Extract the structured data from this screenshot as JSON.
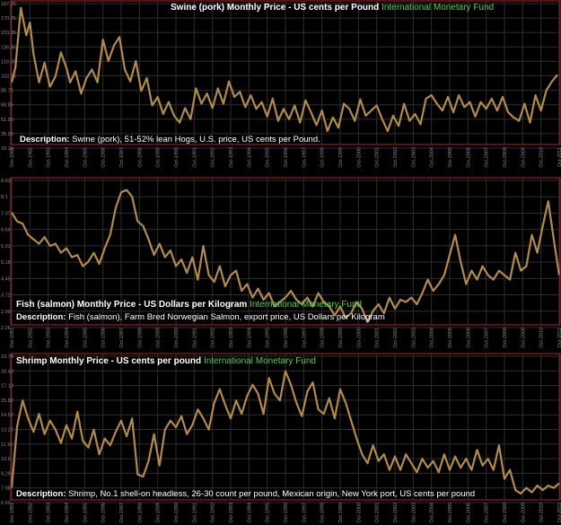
{
  "colors": {
    "line": "#b08a4e",
    "frame": "#a8232b",
    "grid": "#2e2e2e",
    "label": "#8a8a8a",
    "source": "#4fd14f"
  },
  "chart_data": [
    {
      "type": "line",
      "title": "Swine (pork) Monthly Price - US cents per Pound",
      "source": "International Monetary Fund",
      "description_label": "Description:",
      "description": "Swine (pork), 51-52% lean Hogs, U.S. price, US cents per Pound.",
      "y_ticks": [
        "187.15",
        "170.25",
        "153.35",
        "136.45",
        "119.55",
        "102.65",
        "85.75",
        "68.85",
        "51.95",
        "35.05",
        "18.15"
      ],
      "ylim": [
        18.15,
        187.15
      ],
      "x_ticks": [
        "Oct-1981",
        "Oct-1982",
        "Oct-1983",
        "Oct-1984",
        "Oct-1985",
        "Oct-1986",
        "Oct-1987",
        "Oct-1988",
        "Oct-1989",
        "Oct-1990",
        "Oct-1991",
        "Oct-1992",
        "Oct-1993",
        "Oct-1994",
        "Oct-1995",
        "Oct-1996",
        "Oct-1997",
        "Oct-1998",
        "Oct-1999",
        "Oct-2000",
        "Oct-2001",
        "Oct-2002",
        "Oct-2003",
        "Oct-2004",
        "Oct-2005",
        "Oct-2006",
        "Oct-2007",
        "Oct-2008",
        "Oct-2009",
        "Oct-2010",
        "Oct-2011"
      ],
      "series": [
        {
          "x": [
            1981.8,
            1982.0,
            1982.3,
            1982.6,
            1982.8,
            1983.0,
            1983.3,
            1983.6,
            1983.9,
            1984.2,
            1984.5,
            1984.8,
            1985.0,
            1985.3,
            1985.6,
            1985.9,
            1986.2,
            1986.5,
            1986.8,
            1987.1,
            1987.4,
            1987.7,
            1988.0,
            1988.3,
            1988.6,
            1988.9,
            1989.2,
            1989.5,
            1989.8,
            1990.1,
            1990.4,
            1990.7,
            1991.0,
            1991.3,
            1991.6,
            1991.9,
            1992.2,
            1992.5,
            1992.8,
            1993.1,
            1993.4,
            1993.7,
            1994.0,
            1994.3,
            1994.6,
            1994.9,
            1995.2,
            1995.5,
            1995.8,
            1996.1,
            1996.4,
            1996.7,
            1997.0,
            1997.3,
            1997.6,
            1997.9,
            1998.2,
            1998.5,
            1998.8,
            1999.1,
            1999.4,
            1999.7,
            2000.0,
            2000.3,
            2000.6,
            2000.9,
            2001.2,
            2001.5,
            2001.8,
            2002.1,
            2002.4,
            2002.7,
            2003.0,
            2003.3,
            2003.6,
            2003.9,
            2004.2,
            2004.5,
            2004.8,
            2005.1,
            2005.4,
            2005.7,
            2006.0,
            2006.3,
            2006.6,
            2006.9,
            2007.2,
            2007.5,
            2007.8,
            2008.1,
            2008.4,
            2008.7,
            2009.0,
            2009.3,
            2009.6,
            2009.9,
            2010.2,
            2010.5,
            2010.8,
            2011.1,
            2011.4,
            2011.7
          ],
          "y": [
            95,
            112,
            182,
            150,
            165,
            128,
            95,
            118,
            90,
            102,
            130,
            112,
            95,
            108,
            82,
            100,
            110,
            95,
            145,
            120,
            138,
            148,
            110,
            96,
            120,
            85,
            100,
            68,
            78,
            58,
            72,
            56,
            48,
            65,
            52,
            88,
            70,
            82,
            65,
            88,
            70,
            96,
            78,
            84,
            66,
            80,
            64,
            72,
            55,
            76,
            50,
            64,
            52,
            68,
            48,
            74,
            60,
            45,
            62,
            38,
            54,
            42,
            70,
            64,
            50,
            75,
            56,
            62,
            68,
            52,
            38,
            56,
            44,
            70,
            50,
            58,
            46,
            76,
            80,
            70,
            62,
            78,
            60,
            80,
            66,
            72,
            55,
            72,
            64,
            76,
            62,
            78,
            60,
            54,
            50,
            70,
            48,
            80,
            62,
            86,
            96,
            104
          ]
        }
      ]
    },
    {
      "type": "line",
      "title": "Fish (salmon) Monthly Price - US Dollars per Kilogram",
      "source": "International Monetary Fund",
      "description_label": "Description:",
      "description": "Fish (salmon), Farm Bred Norwegian Salmon, export price, US Dollars per Kilogram",
      "y_ticks": [
        "8.83",
        "8.1",
        "7.37",
        "6.64",
        "5.91",
        "5.18",
        "4.45",
        "3.72",
        "2.99",
        "2.26"
      ],
      "ylim": [
        2.26,
        8.83
      ],
      "x_ticks": [
        "Oct-1981",
        "Oct-1982",
        "Oct-1983",
        "Oct-1984",
        "Oct-1985",
        "Oct-1986",
        "Oct-1987",
        "Oct-1988",
        "Oct-1989",
        "Oct-1990",
        "Oct-1991",
        "Oct-1992",
        "Oct-1993",
        "Oct-1994",
        "Oct-1995",
        "Oct-1996",
        "Oct-1997",
        "Oct-1998",
        "Oct-1999",
        "Oct-2000",
        "Oct-2001",
        "Oct-2002",
        "Oct-2003",
        "Oct-2004",
        "Oct-2005",
        "Oct-2006",
        "Oct-2007",
        "Oct-2008",
        "Oct-2009",
        "Oct-2010",
        "Oct-2011"
      ],
      "series": [
        {
          "x": [
            1981.8,
            1982.1,
            1982.4,
            1982.7,
            1983.0,
            1983.3,
            1983.6,
            1983.9,
            1984.2,
            1984.5,
            1984.8,
            1985.1,
            1985.4,
            1985.7,
            1986.0,
            1986.3,
            1986.6,
            1986.9,
            1987.2,
            1987.5,
            1987.8,
            1988.1,
            1988.4,
            1988.7,
            1989.0,
            1989.3,
            1989.6,
            1989.9,
            1990.2,
            1990.5,
            1990.8,
            1991.1,
            1991.4,
            1991.7,
            1992.0,
            1992.3,
            1992.6,
            1992.9,
            1993.2,
            1993.5,
            1993.8,
            1994.1,
            1994.4,
            1994.7,
            1995.0,
            1995.3,
            1995.6,
            1995.9,
            1996.2,
            1996.5,
            1996.8,
            1997.1,
            1997.4,
            1997.7,
            1998.0,
            1998.3,
            1998.6,
            1998.9,
            1999.2,
            1999.5,
            1999.8,
            2000.1,
            2000.4,
            2000.7,
            2001.0,
            2001.3,
            2001.6,
            2001.9,
            2002.2,
            2002.5,
            2002.8,
            2003.1,
            2003.4,
            2003.7,
            2004.0,
            2004.3,
            2004.6,
            2004.9,
            2005.2,
            2005.5,
            2005.8,
            2006.1,
            2006.4,
            2006.7,
            2007.0,
            2007.3,
            2007.6,
            2007.9,
            2008.2,
            2008.5,
            2008.8,
            2009.1,
            2009.4,
            2009.7,
            2010.0,
            2010.3,
            2010.6,
            2010.9,
            2011.2,
            2011.5,
            2011.8
          ],
          "y": [
            7.4,
            7.0,
            6.9,
            6.4,
            6.2,
            6.0,
            6.3,
            5.9,
            6.0,
            5.6,
            5.8,
            5.4,
            5.5,
            5.0,
            5.2,
            5.6,
            5.1,
            5.8,
            6.4,
            7.6,
            8.3,
            8.4,
            8.1,
            7.0,
            6.8,
            6.2,
            5.5,
            6.0,
            5.4,
            5.7,
            5.0,
            5.3,
            4.7,
            5.4,
            4.4,
            5.9,
            4.6,
            4.3,
            5.0,
            4.1,
            4.6,
            4.8,
            3.9,
            4.2,
            3.6,
            4.0,
            3.5,
            3.8,
            3.2,
            3.4,
            3.6,
            3.9,
            3.5,
            3.3,
            3.6,
            3.2,
            3.8,
            3.4,
            3.2,
            2.8,
            3.2,
            2.7,
            2.9,
            3.4,
            3.1,
            2.5,
            3.0,
            3.3,
            2.9,
            3.6,
            3.1,
            3.5,
            3.4,
            3.6,
            3.3,
            3.8,
            4.4,
            3.9,
            4.2,
            4.6,
            5.5,
            6.4,
            5.2,
            4.2,
            4.8,
            4.4,
            5.0,
            4.6,
            4.4,
            4.8,
            4.6,
            4.4,
            5.6,
            4.8,
            5.0,
            6.4,
            5.6,
            6.8,
            7.9,
            6.2,
            4.6
          ]
        }
      ]
    },
    {
      "type": "line",
      "title": "Shrimp Monthly Price - US cents per pound",
      "source": "International Monetary Fund",
      "description_label": "Description:",
      "description": "Shrimp, No.1 shell-on headless, 26-30 count per pound, Mexican origin, New York port, US cents per pound",
      "y_ticks": [
        "19.74",
        "18.43",
        "17.13",
        "15.82",
        "14.52",
        "13.22",
        "11.91",
        "10.6",
        "9.29",
        "7.98",
        "6.69"
      ],
      "ylim": [
        6.69,
        19.74
      ],
      "x_ticks": [
        "Oct-1981",
        "Oct-1982",
        "Oct-1983",
        "Oct-1984",
        "Oct-1985",
        "Oct-1986",
        "Oct-1987",
        "Oct-1988",
        "Oct-1989",
        "Oct-1990",
        "Oct-1991",
        "Oct-1992",
        "Oct-1993",
        "Oct-1994",
        "Oct-1995",
        "Oct-1996",
        "Oct-1997",
        "Oct-1998",
        "Oct-1999",
        "Oct-2000",
        "Oct-2001",
        "Oct-2002",
        "Oct-2003",
        "Oct-2004",
        "Oct-2005",
        "Oct-2006",
        "Oct-2007",
        "Oct-2008",
        "Oct-2009",
        "Oct-2010",
        "Oct-2011"
      ],
      "series": [
        {
          "x": [
            1981.8,
            1982.1,
            1982.4,
            1982.7,
            1983.0,
            1983.3,
            1983.6,
            1983.9,
            1984.2,
            1984.5,
            1984.8,
            1985.1,
            1985.4,
            1985.7,
            1986.0,
            1986.3,
            1986.6,
            1986.9,
            1987.2,
            1987.5,
            1987.8,
            1988.1,
            1988.4,
            1988.7,
            1989.0,
            1989.3,
            1989.6,
            1989.9,
            1990.2,
            1990.5,
            1990.8,
            1991.1,
            1991.4,
            1991.7,
            1992.0,
            1992.3,
            1992.6,
            1992.9,
            1993.2,
            1993.5,
            1993.8,
            1994.1,
            1994.4,
            1994.7,
            1995.0,
            1995.3,
            1995.6,
            1995.9,
            1996.2,
            1996.5,
            1996.8,
            1997.1,
            1997.4,
            1997.7,
            1998.0,
            1998.3,
            1998.6,
            1998.9,
            1999.2,
            1999.5,
            1999.8,
            2000.1,
            2000.4,
            2000.7,
            2001.0,
            2001.3,
            2001.6,
            2001.9,
            2002.2,
            2002.5,
            2002.8,
            2003.1,
            2003.4,
            2003.7,
            2004.0,
            2004.3,
            2004.6,
            2004.9,
            2005.2,
            2005.5,
            2005.8,
            2006.1,
            2006.4,
            2006.7,
            2007.0,
            2007.3,
            2007.6,
            2007.9,
            2008.2,
            2008.5,
            2008.8,
            2009.1,
            2009.4,
            2009.7,
            2010.0,
            2010.3,
            2010.6,
            2010.9,
            2011.2,
            2011.5,
            2011.8
          ],
          "y": [
            8.0,
            13.5,
            15.8,
            14.2,
            13.0,
            14.6,
            12.8,
            14.0,
            13.2,
            12.0,
            13.6,
            12.4,
            14.8,
            12.2,
            11.6,
            13.2,
            11.0,
            12.4,
            11.8,
            13.0,
            14.0,
            12.6,
            14.2,
            9.2,
            9.0,
            10.4,
            12.8,
            10.0,
            13.2,
            14.0,
            13.4,
            14.4,
            12.8,
            13.6,
            15.0,
            14.2,
            13.2,
            15.6,
            16.8,
            15.4,
            14.2,
            15.8,
            14.6,
            16.2,
            17.2,
            16.4,
            14.6,
            17.8,
            16.4,
            15.8,
            18.4,
            17.2,
            15.6,
            14.4,
            16.6,
            17.4,
            15.0,
            14.6,
            16.0,
            14.2,
            16.8,
            15.6,
            14.0,
            12.4,
            11.0,
            10.2,
            11.8,
            10.4,
            11.0,
            9.6,
            10.8,
            9.6,
            11.0,
            10.2,
            9.4,
            10.6,
            9.8,
            10.4,
            9.4,
            11.0,
            9.6,
            10.8,
            9.8,
            10.6,
            9.6,
            11.4,
            10.0,
            10.6,
            9.6,
            11.8,
            8.8,
            9.6,
            7.8,
            7.5,
            8.0,
            7.6,
            8.2,
            7.8,
            8.2,
            8.0,
            8.4
          ]
        }
      ]
    }
  ]
}
